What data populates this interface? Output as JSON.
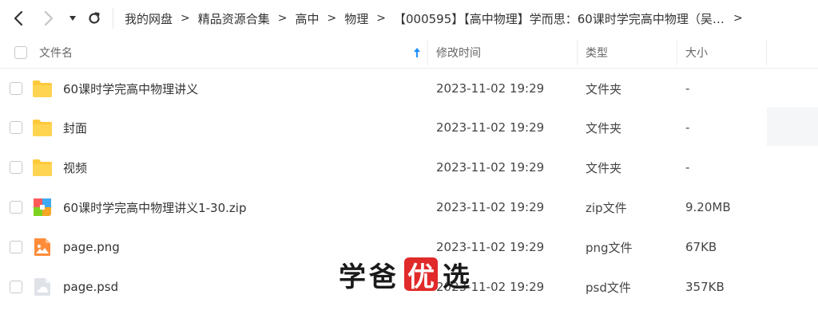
{
  "breadcrumb": {
    "items": [
      "我的网盘",
      "精品资源合集",
      "高中",
      "物理",
      "【000595】【高中物理】学而思：60课时学完高中物理（吴海波赵玮孙..."
    ],
    "separator": ">"
  },
  "columns": {
    "name": "文件名",
    "modified": "修改时间",
    "type": "类型",
    "size": "大小"
  },
  "files": [
    {
      "name": "60课时学完高中物理讲义",
      "modified": "2023-11-02 19:29",
      "type": "文件夹",
      "size": "-",
      "icon": "folder-icon"
    },
    {
      "name": "封面",
      "modified": "2023-11-02 19:29",
      "type": "文件夹",
      "size": "-",
      "icon": "folder-icon"
    },
    {
      "name": "视频",
      "modified": "2023-11-02 19:29",
      "type": "文件夹",
      "size": "-",
      "icon": "folder-icon"
    },
    {
      "name": "60课时学完高中物理讲义1-30.zip",
      "modified": "2023-11-02 19:29",
      "type": "zip文件",
      "size": "9.20MB",
      "icon": "zip-file-icon"
    },
    {
      "name": "page.png",
      "modified": "2023-11-02 19:29",
      "type": "png文件",
      "size": "67KB",
      "icon": "image-file-icon"
    },
    {
      "name": "page.psd",
      "modified": "2023-11-02 19:29",
      "type": "psd文件",
      "size": "357KB",
      "icon": "psd-file-icon"
    }
  ],
  "watermark": {
    "part1": "学爸",
    "badge": "优",
    "part2": "选"
  },
  "colors": {
    "accent": "#1f8fff",
    "folder": "#ffc93c",
    "watermark_red": "#e12a2a"
  }
}
